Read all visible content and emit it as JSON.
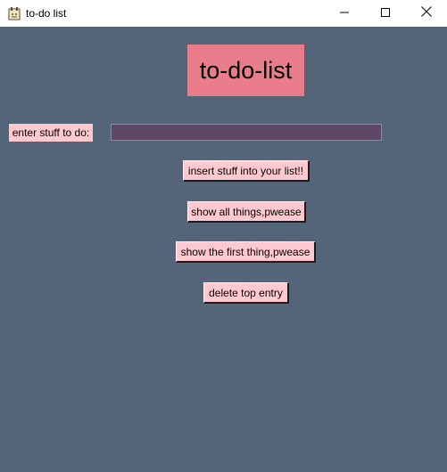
{
  "window": {
    "title": "to-do list",
    "app_icon": "notepad-icon",
    "controls": {
      "minimize": "minimize-icon",
      "maximize": "maximize-icon",
      "close": "close-icon"
    }
  },
  "app": {
    "heading": "to-do-list",
    "entry_label": "enter stuff to do:",
    "entry_value": "",
    "buttons": {
      "insert": "insert stuff into your list!!",
      "show_all": "show all things,pwease",
      "show_first": "show the first thing,pwease",
      "delete_top": "delete top entry"
    }
  },
  "colors": {
    "background": "#546479",
    "heading_bg": "#e97d8c",
    "button_bg": "#ffc9cf",
    "entry_bg": "#5c4864"
  }
}
